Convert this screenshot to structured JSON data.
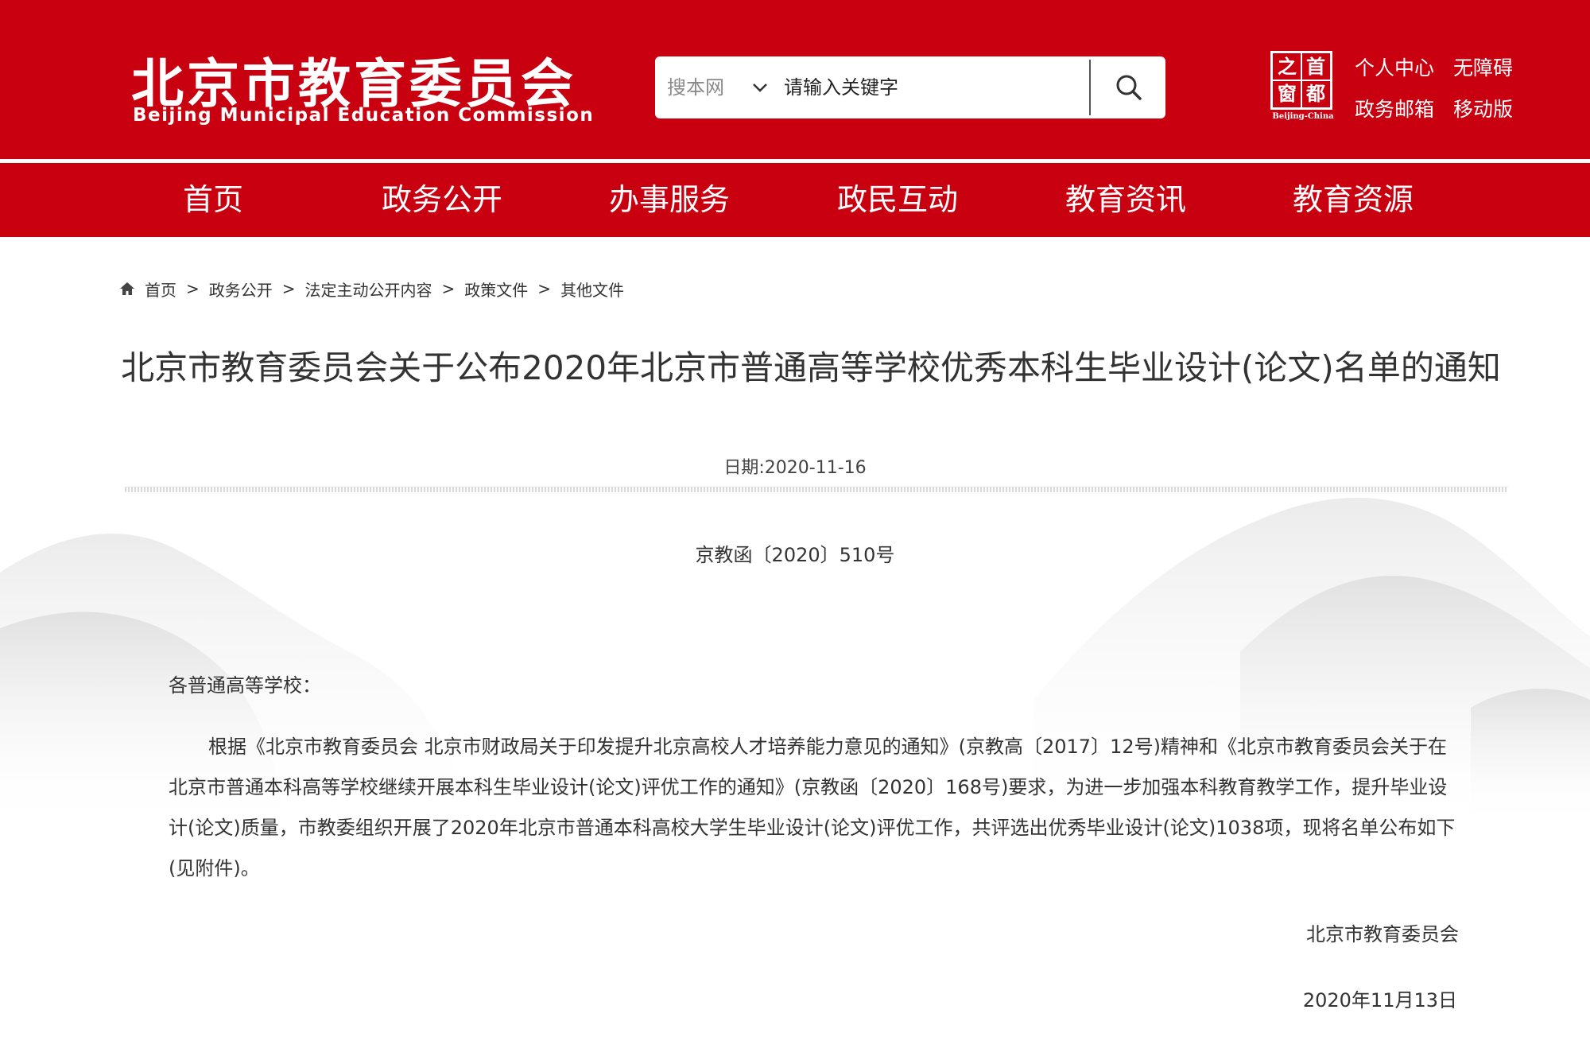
{
  "header": {
    "logo_cn": "北京市教育委员会",
    "logo_en": "Beijing Municipal Education Commission",
    "search": {
      "scope": "搜本网",
      "placeholder": "请输入关键字"
    },
    "seal": {
      "chars": [
        "之",
        "首",
        "窗",
        "都"
      ],
      "caption": "Beijing-China"
    },
    "links": [
      "个人中心",
      "无障碍",
      "政务邮箱",
      "移动版"
    ]
  },
  "nav": {
    "items": [
      "首页",
      "政务公开",
      "办事服务",
      "政民互动",
      "教育资讯",
      "教育资源"
    ]
  },
  "breadcrumb": {
    "items": [
      "首页",
      "政务公开",
      "法定主动公开内容",
      "政策文件",
      "其他文件"
    ],
    "separator": ">"
  },
  "article": {
    "title": "北京市教育委员会关于公布2020年北京市普通高等学校优秀本科生毕业设计(论文)名单的通知",
    "date": "日期:2020-11-16",
    "doc_number": "京教函〔2020〕510号",
    "salutation": "各普通高等学校：",
    "body": "根据《北京市教育委员会 北京市财政局关于印发提升北京高校人才培养能力意见的通知》(京教高〔2017〕12号)精神和《北京市教育委员会关于在北京市普通本科高等学校继续开展本科生毕业设计(论文)评优工作的通知》(京教函〔2020〕168号)要求，为进一步加强本科教育教学工作，提升毕业设计(论文)质量，市教委组织开展了2020年北京市普通本科高校大学生毕业设计(论文)评优工作，共评选出优秀毕业设计(论文)1038项，现将名单公布如下(见附件)。",
    "signature": "北京市教育委员会",
    "sign_date": "2020年11月13日"
  },
  "colors": {
    "brand_red": "#c8000f",
    "text": "#333333",
    "white": "#ffffff"
  }
}
